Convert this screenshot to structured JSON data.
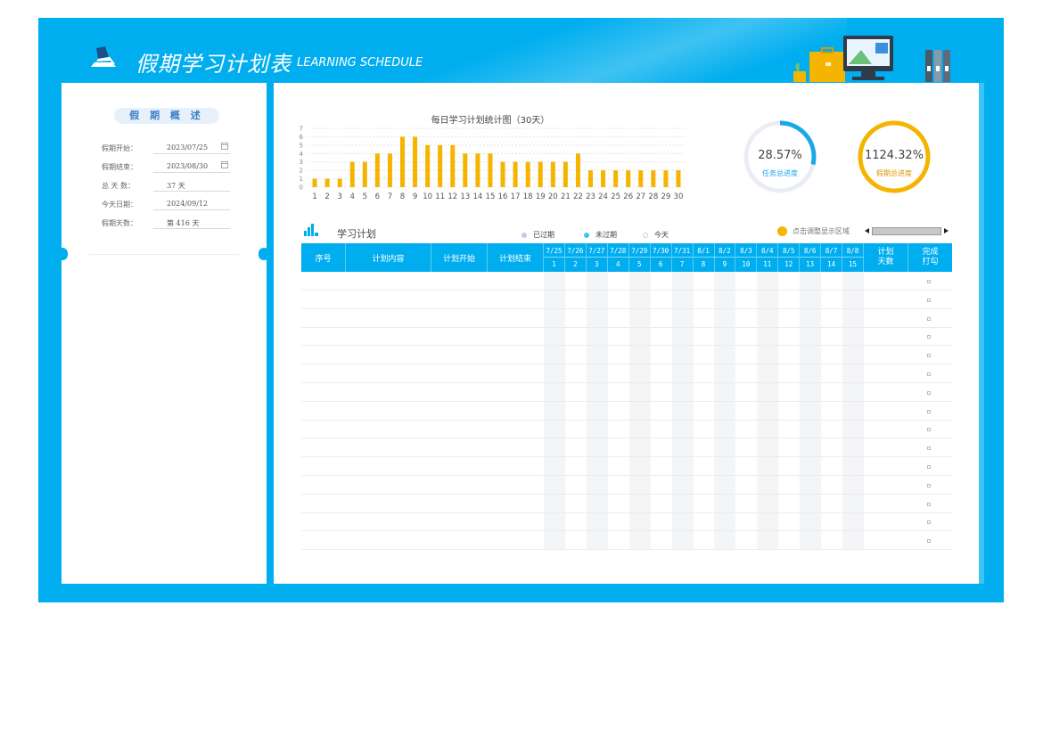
{
  "header": {
    "title": "假期学习计划表",
    "subtitle": "LEARNING SCHEDULE",
    "logo_icon": "desk-lamp-icon",
    "decoration_icon": "office-illustration-icon"
  },
  "overview": {
    "title": "假 期 概 述",
    "rows": [
      {
        "label": "假期开始：",
        "value": "2023/07/25",
        "icon": "calendar-icon"
      },
      {
        "label": "假期结束：",
        "value": "2023/08/30",
        "icon": "calendar-icon"
      },
      {
        "label": "总 天 数：",
        "value": "37 天"
      },
      {
        "label": "今天日期：",
        "value": "2024/09/12"
      },
      {
        "label": "假期天数：",
        "value": "第 416 天"
      }
    ]
  },
  "chart_data": {
    "type": "bar",
    "title": "每日学习计划统计图（30天）",
    "categories": [
      "1",
      "2",
      "3",
      "4",
      "5",
      "6",
      "7",
      "8",
      "9",
      "10",
      "11",
      "12",
      "13",
      "14",
      "15",
      "16",
      "17",
      "18",
      "19",
      "20",
      "21",
      "22",
      "23",
      "24",
      "25",
      "26",
      "27",
      "28",
      "29",
      "30"
    ],
    "values": [
      1,
      1,
      1,
      3,
      3,
      4,
      4,
      6,
      6,
      5,
      5,
      5,
      4,
      4,
      4,
      3,
      3,
      3,
      3,
      3,
      3,
      4,
      2,
      2,
      2,
      2,
      2,
      2,
      2,
      2
    ],
    "yticks": [
      "0",
      "1",
      "2",
      "3",
      "4",
      "5",
      "6",
      "7"
    ],
    "ylim": [
      0,
      7
    ],
    "grid": true,
    "bar_color": "#f5b400"
  },
  "progress": {
    "task": {
      "value": "28.57%",
      "label": "任务总进度",
      "fraction": 0.2857,
      "color": "#1aa8e8",
      "track": "#ececf6"
    },
    "vacation": {
      "value": "1124.32%",
      "label": "假期总进度",
      "fraction": 1.0,
      "color": "#f5b400",
      "track": "#fdf1d6"
    }
  },
  "plan": {
    "title": "学习计划",
    "title_icon": "bar-chart-icon",
    "legend": [
      {
        "label": "已过期",
        "color": "#c8c8e6"
      },
      {
        "label": "未过期",
        "color": "#3ec3f3"
      },
      {
        "label": "今天",
        "color": "#ffffff"
      }
    ],
    "hint": "点击调整显示区域",
    "hint_icon": "info-dot-icon",
    "headers": {
      "index": "序号",
      "content": "计划内容",
      "start": "计划开始",
      "end": "计划结束",
      "days": [
        "计划",
        "天数"
      ],
      "done": [
        "完成",
        "打勾"
      ]
    },
    "dates": [
      "7/25",
      "7/26",
      "7/27",
      "7/28",
      "7/29",
      "7/30",
      "7/31",
      "8/1",
      "8/2",
      "8/3",
      "8/4",
      "8/5",
      "8/6",
      "8/7",
      "8/8"
    ],
    "day_numbers": [
      "1",
      "2",
      "3",
      "4",
      "5",
      "6",
      "7",
      "8",
      "9",
      "10",
      "11",
      "12",
      "13",
      "14",
      "15"
    ],
    "row_count": 15,
    "header_color": "#00aeef"
  }
}
